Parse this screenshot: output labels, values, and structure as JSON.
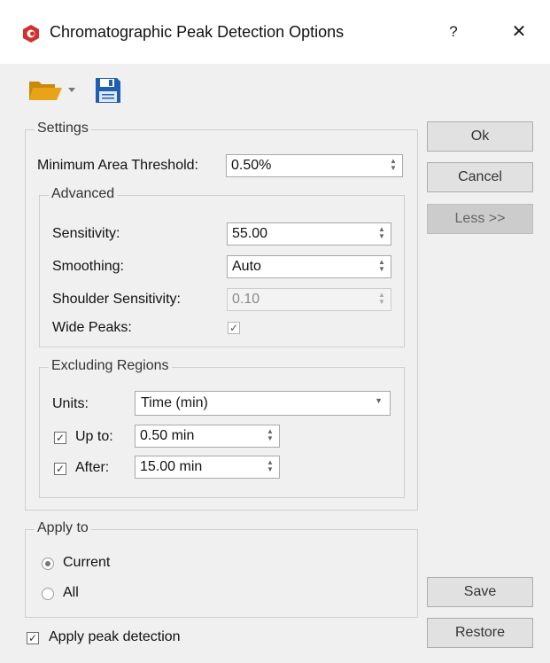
{
  "window": {
    "title": "Chromatographic Peak Detection Options",
    "help_label": "?",
    "close_label": "✕"
  },
  "icons": {
    "app": "app-logo-icon",
    "open": "folder-open-icon",
    "open_menu": "dropdown-arrow-icon",
    "save": "floppy-disk-icon"
  },
  "settings": {
    "legend": "Settings",
    "min_area_label": "Minimum Area Threshold:",
    "min_area_value": "0.50%",
    "advanced": {
      "legend": "Advanced",
      "sensitivity_label": "Sensitivity:",
      "sensitivity_value": "55.00",
      "smoothing_label": "Smoothing:",
      "smoothing_value": "Auto",
      "shoulder_label": "Shoulder Sensitivity:",
      "shoulder_value": "0.10",
      "wide_peaks_label": "Wide Peaks:",
      "wide_peaks_checked": true
    },
    "excluding": {
      "legend": "Excluding Regions",
      "units_label": "Units:",
      "units_value": "Time (min)",
      "upto_label": "Up to:",
      "upto_checked": true,
      "upto_value": "0.50 min",
      "after_label": "After:",
      "after_checked": true,
      "after_value": "15.00 min"
    }
  },
  "apply_to": {
    "legend": "Apply to",
    "options": [
      "Current",
      "All"
    ],
    "selected": "Current"
  },
  "apply_peak_detection": {
    "label": "Apply peak detection",
    "checked": true
  },
  "buttons": {
    "ok": "Ok",
    "cancel": "Cancel",
    "less": "Less >>",
    "save": "Save",
    "restore": "Restore"
  },
  "colors": {
    "dialog_bg": "#f0f0f0",
    "titlebar_bg": "#ffffff",
    "logo_red": "#d32f2f",
    "folder_orange": "#e8a317",
    "floppy_blue": "#1f5fb0"
  }
}
